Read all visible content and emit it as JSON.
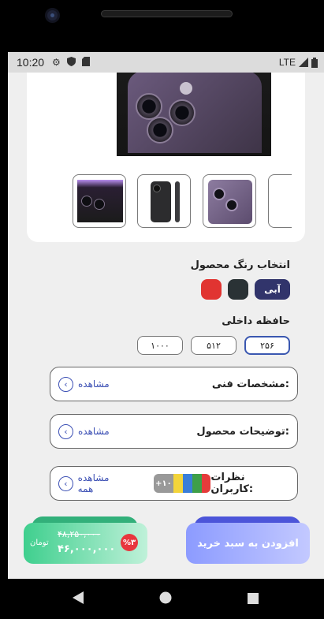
{
  "status_bar": {
    "time": "10:20",
    "network": "LTE"
  },
  "color_section": {
    "title": "انتخاب رنگ محصول",
    "selected_label": "آبی",
    "colors": [
      "#e13431",
      "#2a3235"
    ]
  },
  "memory_section": {
    "title": "حافظه داخلی",
    "options": [
      "۲۵۶",
      "۵۱۲",
      "۱۰۰۰"
    ]
  },
  "specs_row": {
    "label": "مشخصات فنی:",
    "link": "مشاهده"
  },
  "description_row": {
    "label": "توضیحات محصول:",
    "link": "مشاهده"
  },
  "reviews_row": {
    "label": "نظرات کاربران:",
    "link": "مشاهده همه",
    "count": "+۱۰",
    "avatar_colors": [
      "#e53b3b",
      "#3e9f49",
      "#3a7ed8",
      "#f3d43a"
    ]
  },
  "cta": {
    "add_to_cart": "افزودن به سبد خرید",
    "discount": "%۳",
    "old_price": "۴۸,۲۵۰,۰۰۰",
    "new_price": "۴۶,۰۰۰,۰۰۰",
    "currency": "تومان"
  },
  "theme": {
    "accent": "#31346b",
    "link": "#3b4fb4",
    "cta_blue": "#8c9bff",
    "cta_green": "#2fcf8a",
    "badge_red": "#e8363d"
  }
}
